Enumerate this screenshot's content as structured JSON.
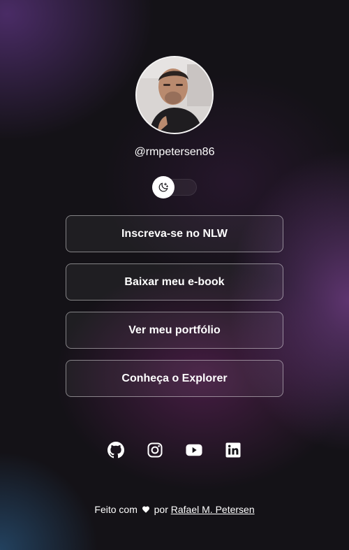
{
  "profile": {
    "handle": "@rmpetersen86"
  },
  "theme_toggle": {
    "icon": "moon-stars-icon",
    "state": "dark"
  },
  "links": [
    {
      "label": "Inscreva-se no NLW"
    },
    {
      "label": "Baixar meu e-book"
    },
    {
      "label": "Ver meu portfólio"
    },
    {
      "label": "Conheça o Explorer"
    }
  ],
  "social": [
    {
      "icon": "github-icon"
    },
    {
      "icon": "instagram-icon"
    },
    {
      "icon": "youtube-icon"
    },
    {
      "icon": "linkedin-icon"
    }
  ],
  "footer": {
    "made_with": "Feito com",
    "heart_icon": "heart-icon",
    "by": "por",
    "author": "Rafael M. Petersen"
  },
  "colors": {
    "text": "#ffffff",
    "background": "#141217",
    "accent_purple": "#76408c",
    "accent_blue": "#285278"
  }
}
